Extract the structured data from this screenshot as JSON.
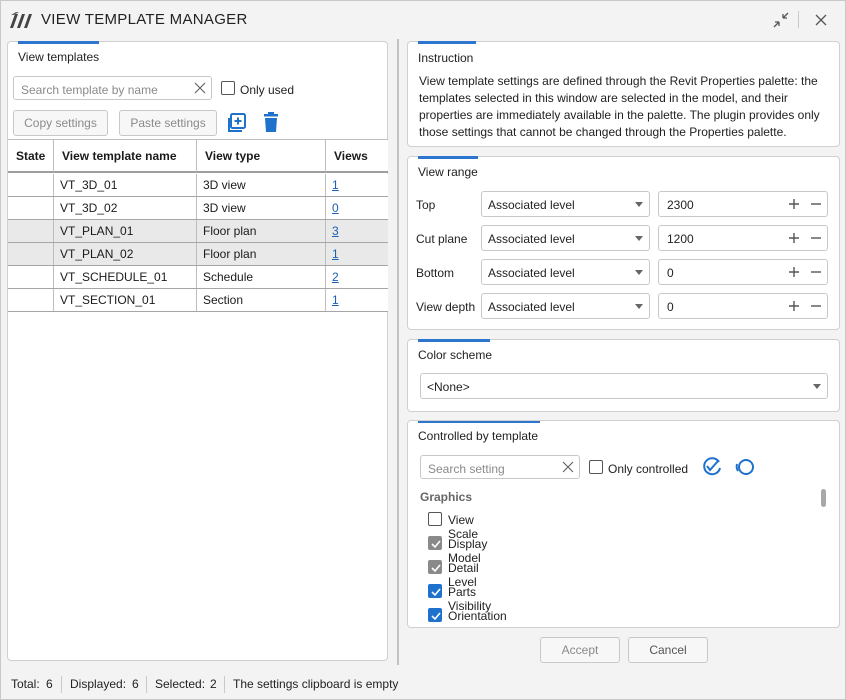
{
  "window": {
    "title": "VIEW TEMPLATE MANAGER"
  },
  "left_panel": {
    "title": "View templates",
    "search_placeholder": "Search template by name",
    "only_used_label": "Only used",
    "copy_settings_label": "Copy settings",
    "paste_settings_label": "Paste settings",
    "table": {
      "headers": [
        "State",
        "View template name",
        "View type",
        "Views"
      ],
      "rows": [
        {
          "state": "",
          "name": "VT_3D_01",
          "type": "3D view",
          "views": "1",
          "selected": false
        },
        {
          "state": "",
          "name": "VT_3D_02",
          "type": "3D view",
          "views": "0",
          "selected": false
        },
        {
          "state": "",
          "name": "VT_PLAN_01",
          "type": "Floor plan",
          "views": "3",
          "selected": true
        },
        {
          "state": "",
          "name": "VT_PLAN_02",
          "type": "Floor plan",
          "views": "1",
          "selected": true
        },
        {
          "state": "",
          "name": "VT_SCHEDULE_01",
          "type": "Schedule",
          "views": "2",
          "selected": false
        },
        {
          "state": "",
          "name": "VT_SECTION_01",
          "type": "Section",
          "views": "1",
          "selected": false
        }
      ]
    }
  },
  "instruction": {
    "title": "Instruction",
    "text": "View template settings are defined through the Revit Properties palette: the templates selected in this window are selected in the model, and their properties are immediately available in the palette. The plugin provides only those settings that cannot be changed through the Properties palette."
  },
  "view_range": {
    "title": "View range",
    "rows": [
      {
        "label": "Top",
        "level": "Associated level",
        "offset": "2300"
      },
      {
        "label": "Cut plane",
        "level": "Associated level",
        "offset": "1200"
      },
      {
        "label": "Bottom",
        "level": "Associated level",
        "offset": "0"
      },
      {
        "label": "View depth",
        "level": "Associated level",
        "offset": "0"
      }
    ]
  },
  "color_scheme": {
    "title": "Color scheme",
    "value": "<None>"
  },
  "controlled": {
    "title": "Controlled by template",
    "search_placeholder": "Search setting",
    "only_controlled_label": "Only controlled",
    "group_label": "Graphics",
    "items": [
      {
        "label": "View Scale",
        "state": "unchecked"
      },
      {
        "label": "Display Model",
        "state": "checked-grey"
      },
      {
        "label": "Detail Level",
        "state": "checked-grey"
      },
      {
        "label": "Parts Visibility",
        "state": "checked-blue"
      },
      {
        "label": "Orientation",
        "state": "checked-blue"
      }
    ]
  },
  "footer": {
    "accept_label": "Accept",
    "cancel_label": "Cancel"
  },
  "status": {
    "total_label": "Total:",
    "total_value": "6",
    "displayed_label": "Displayed:",
    "displayed_value": "6",
    "selected_label": "Selected:",
    "selected_value": "2",
    "clipboard_text": "The settings clipboard is empty"
  },
  "colors": {
    "accent": "#2d76cf",
    "link": "#1a5fb4",
    "selected_row": "#e9e9e9"
  }
}
